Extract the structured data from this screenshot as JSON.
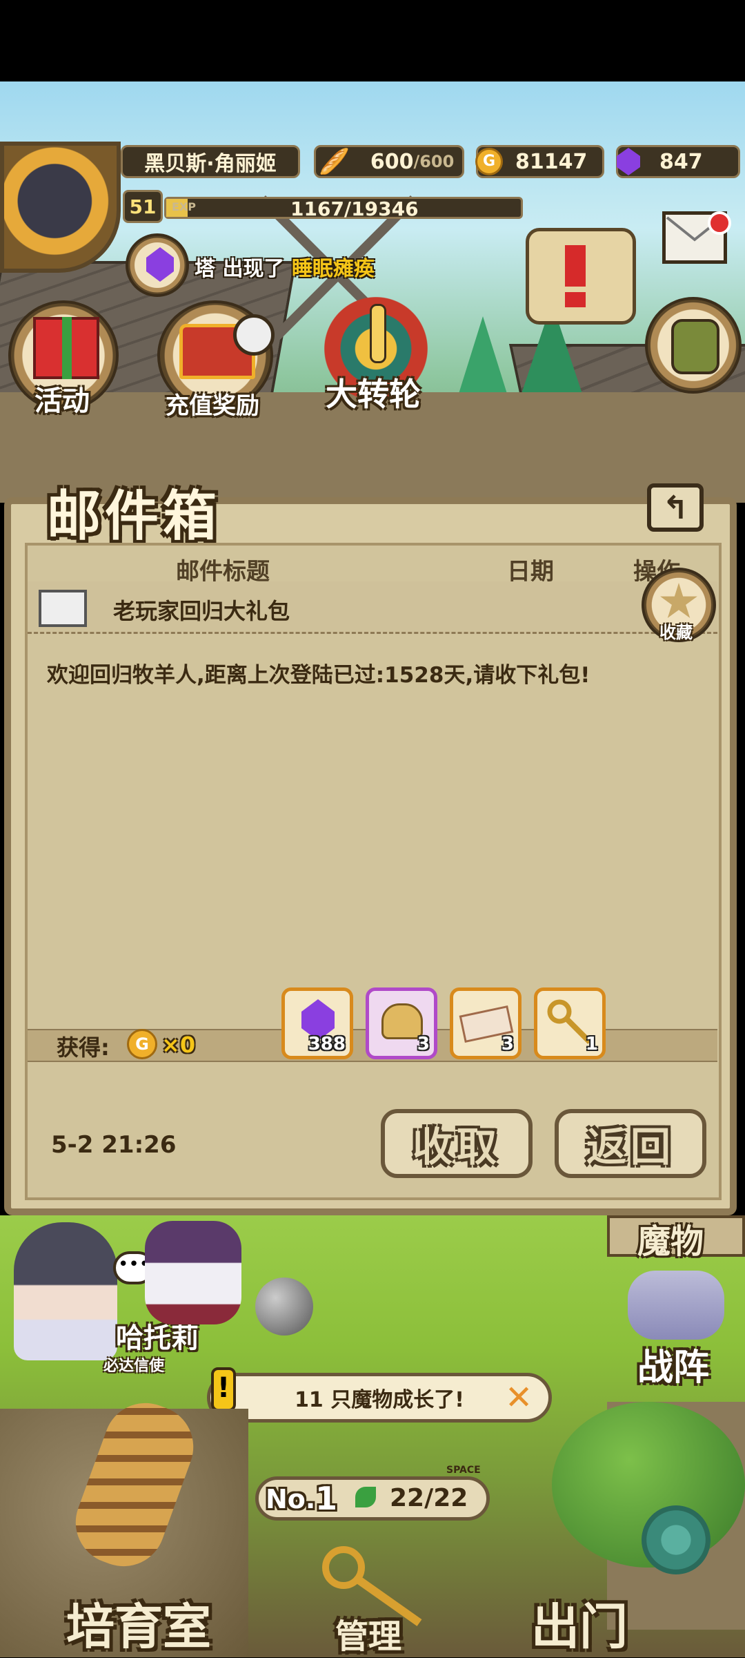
{
  "header": {
    "player_name": "黑贝斯·角丽姬",
    "level": "51",
    "exp_label": "EXP",
    "exp_value": "1167/19346",
    "exp_fraction": 0.06,
    "bread_current": "600",
    "bread_max": "/600",
    "gold": "81147",
    "gems": "847"
  },
  "notice_banner": {
    "prefix": "塔 出现了",
    "highlight": "睡眠瘫痪"
  },
  "menu": {
    "activity": "活动",
    "recharge_reward": "充值奖励",
    "wheel": "大转轮"
  },
  "mailbox": {
    "title": "邮件箱",
    "columns": [
      "邮件标题",
      "日期",
      "操作"
    ],
    "mail_subject": "老玩家回归大礼包",
    "favorite_label": "收藏",
    "body": "欢迎回归牧羊人,距离上次登陆已过:1528天,请收下礼包!",
    "obtain_label": "获得:",
    "gold_amount": "×0",
    "rewards": [
      {
        "icon": "purple-gem",
        "count": "388"
      },
      {
        "icon": "gold-sack",
        "count": "3"
      },
      {
        "icon": "ticket",
        "count": "3"
      },
      {
        "icon": "gold-key",
        "count": "1"
      }
    ],
    "date": "5-2 21:26",
    "collect_button": "收取",
    "back_button": "返回"
  },
  "field": {
    "character_name": "哈托莉",
    "character_role": "必达信使",
    "monster_label": "魔物",
    "formation_label": "战阵",
    "growth_notice": "11 只魔物成长了!",
    "rank_label": "No.",
    "rank_value": "1",
    "space_label": "SPACE",
    "space_value": "22/22",
    "nursery": "培育室",
    "manage": "管理",
    "exit": "出门"
  },
  "colors": {
    "accent_orange": "#d88a1c",
    "highlight_yellow": "#f5c518",
    "parchment": "#d8cba3"
  }
}
